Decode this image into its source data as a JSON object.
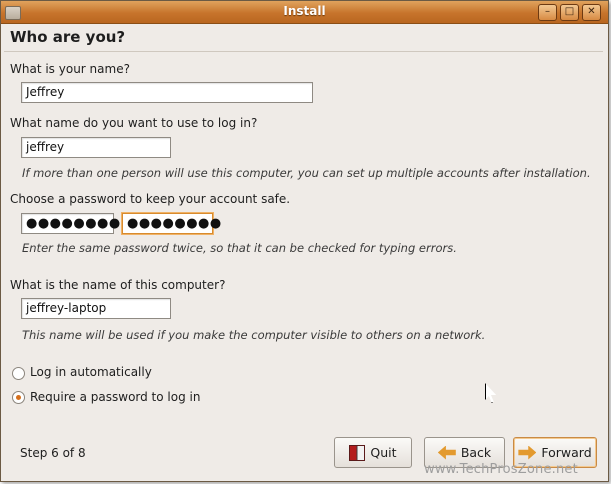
{
  "window": {
    "title": "Install",
    "min_glyph": "–",
    "max_glyph": "□",
    "close_glyph": "✕"
  },
  "heading": "Who are you?",
  "name": {
    "label": "What is your name?",
    "value": "Jeffrey"
  },
  "login": {
    "label": "What name do you want to use to log in?",
    "value": "jeffrey",
    "hint": "If more than one person will use this computer, you can set up multiple accounts after installation."
  },
  "password": {
    "label": "Choose a password to keep your account safe.",
    "value": "●●●●●●●●",
    "confirm_value": "●●●●●●●●",
    "hint": "Enter the same password twice, so that it can be checked for typing errors."
  },
  "computer": {
    "label": "What is the name of this computer?",
    "value": "jeffrey-laptop",
    "hint": "This name will be used if you make the computer visible to others on a network."
  },
  "options": [
    {
      "label": "Log in automatically",
      "checked": false
    },
    {
      "label": "Require a password to log in",
      "checked": true
    }
  ],
  "footer": {
    "step": "Step 6 of 8",
    "quit_label": "Quit",
    "back_label": "Back",
    "forward_label": "Forward"
  },
  "icons": [
    "window-menu-icon",
    "quit-icon",
    "back-arrow-icon",
    "forward-arrow-icon",
    "mouse-cursor-icon"
  ],
  "colors": {
    "titlebar": "#c7742c",
    "focus": "#d88b2e",
    "radio": "#d56f1d",
    "arrow": "#e39a2f"
  },
  "watermark": "www.TechProsZone.net"
}
